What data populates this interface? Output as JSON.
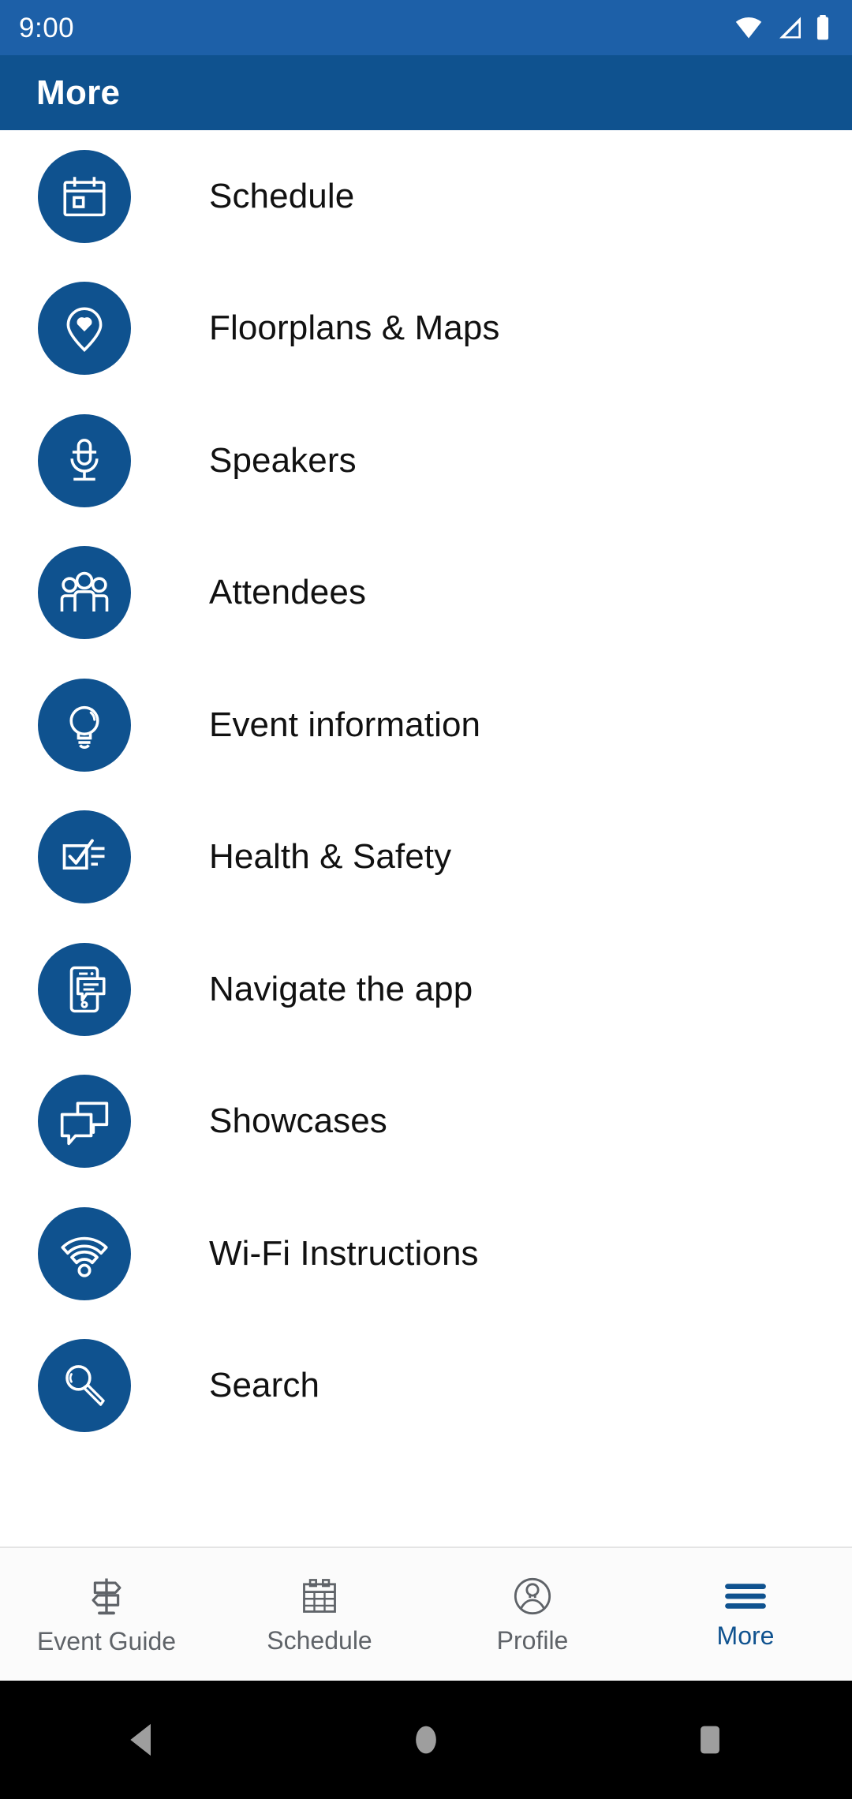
{
  "status_bar": {
    "clock": "9:00",
    "icons": [
      "wifi-icon",
      "cellular-signal-icon",
      "battery-icon"
    ],
    "background": "#1d60a8"
  },
  "app_bar": {
    "title": "More",
    "background": "#0f528f"
  },
  "theme": {
    "brand_blue": "#0f528f",
    "status_blue": "#1d60a8",
    "inactive_gray": "#5f6368",
    "text_black": "#111111"
  },
  "menu": {
    "items": [
      {
        "label": "Schedule",
        "icon": "calendar-icon"
      },
      {
        "label": "Floorplans & Maps",
        "icon": "map-pin-heart-icon"
      },
      {
        "label": "Speakers",
        "icon": "microphone-icon"
      },
      {
        "label": "Attendees",
        "icon": "people-group-icon"
      },
      {
        "label": "Event information",
        "icon": "lightbulb-icon"
      },
      {
        "label": "Health & Safety",
        "icon": "checklist-icon"
      },
      {
        "label": "Navigate the app",
        "icon": "phone-message-icon"
      },
      {
        "label": "Showcases",
        "icon": "speech-bubbles-icon"
      },
      {
        "label": "Wi-Fi Instructions",
        "icon": "wifi-signal-icon"
      },
      {
        "label": "Search",
        "icon": "magnifier-icon"
      }
    ]
  },
  "bottom_nav": {
    "items": [
      {
        "label": "Event Guide",
        "icon": "signpost-icon",
        "active": false
      },
      {
        "label": "Schedule",
        "icon": "calendar-grid-icon",
        "active": false
      },
      {
        "label": "Profile",
        "icon": "person-circle-icon",
        "active": false
      },
      {
        "label": "More",
        "icon": "hamburger-icon",
        "active": true
      }
    ]
  },
  "android_nav": {
    "back": "back-triangle-icon",
    "home": "home-circle-icon",
    "recents": "recents-square-icon"
  }
}
